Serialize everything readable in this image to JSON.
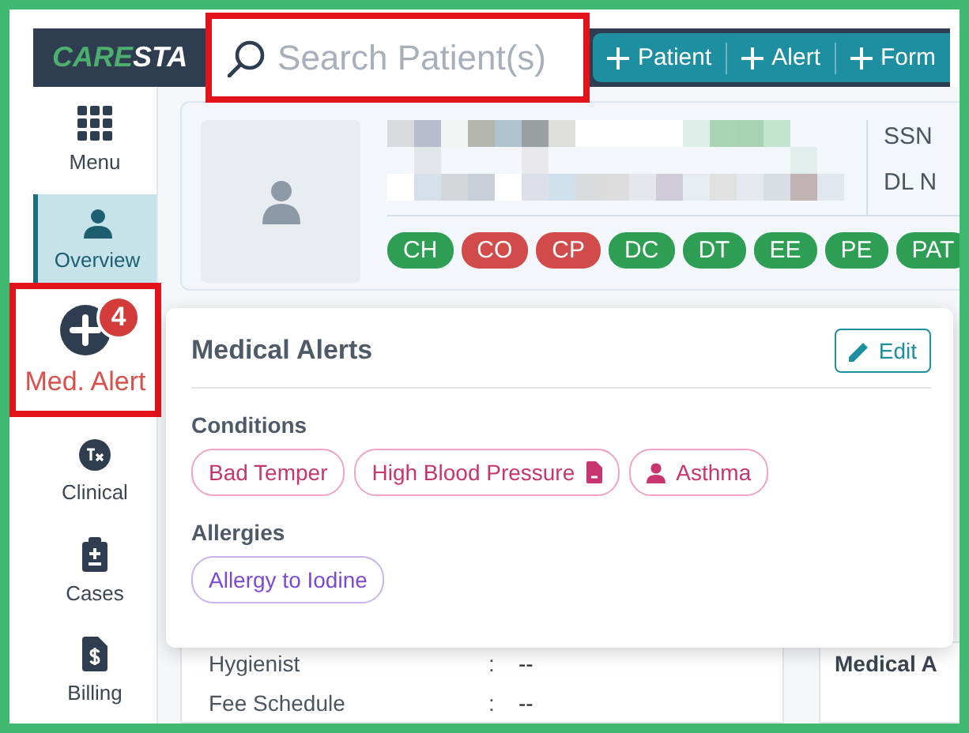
{
  "header": {
    "logo": {
      "part_1": "CARE",
      "part_2": "STA"
    },
    "search": {
      "placeholder": "Search Patient(s)",
      "annotated": true
    },
    "actions": [
      {
        "label": "Patient"
      },
      {
        "label": "Alert"
      },
      {
        "label": "Form"
      }
    ]
  },
  "sidebar": {
    "items": [
      {
        "label": "Menu",
        "selected": false,
        "annotated": false
      },
      {
        "label": "Overview",
        "selected": true,
        "annotated": false
      },
      {
        "label": "Med. Alert",
        "badge": "4",
        "kind": "alert",
        "selected": false,
        "annotated": true
      },
      {
        "label": "Clinical",
        "selected": false,
        "annotated": false
      },
      {
        "label": "Cases",
        "selected": false,
        "annotated": false
      },
      {
        "label": "Billing",
        "selected": false,
        "annotated": false
      }
    ]
  },
  "patient_card": {
    "fields": [
      "SSN",
      "DL N"
    ],
    "tags": [
      {
        "label": "CH",
        "color": "#2e9e55"
      },
      {
        "label": "CO",
        "color": "#d24b4b"
      },
      {
        "label": "CP",
        "color": "#d24b4b"
      },
      {
        "label": "DC",
        "color": "#2e9e55"
      },
      {
        "label": "DT",
        "color": "#2e9e55"
      },
      {
        "label": "EE",
        "color": "#2e9e55"
      },
      {
        "label": "PE",
        "color": "#2e9e55"
      },
      {
        "label": "PAT",
        "color": "#2e9e55"
      }
    ]
  },
  "medical_alerts_popup": {
    "title": "Medical Alerts",
    "edit_button": "Edit",
    "sections": [
      {
        "title": "Conditions",
        "kind": "condition",
        "chips": [
          {
            "label": "Bad Temper",
            "kind": "plain"
          },
          {
            "label": "High Blood Pressure",
            "kind": "document"
          },
          {
            "label": "Asthma",
            "kind": "person"
          }
        ]
      },
      {
        "title": "Allergies",
        "kind": "allergy",
        "chips": [
          {
            "label": "Allergy to Iodine",
            "kind": "plain"
          }
        ]
      }
    ]
  },
  "details": {
    "rows": [
      {
        "label": "Hygienist",
        "separator": ":",
        "value": "--"
      },
      {
        "label": "Fee Schedule",
        "separator": ":",
        "value": "--"
      }
    ]
  },
  "side_panel": {
    "title": "Medical A"
  }
}
